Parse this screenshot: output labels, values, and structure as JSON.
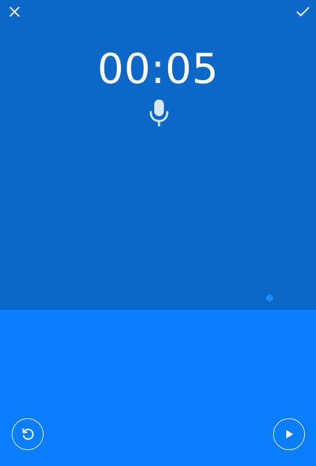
{
  "recorder": {
    "elapsed_time": "00:05",
    "state": "recording"
  },
  "icons": {
    "close": "close-icon",
    "confirm": "check-icon",
    "microphone": "microphone-icon",
    "reset": "reset-icon",
    "play": "play-icon"
  },
  "colors": {
    "top_panel": "#0D67C6",
    "bottom_panel": "#0A7EFF",
    "foreground": "#FFFFFF",
    "mic_tint": "#D8E8FF"
  }
}
